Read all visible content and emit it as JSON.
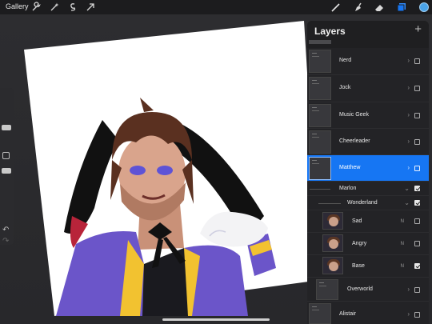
{
  "topbar": {
    "gallery_label": "Gallery",
    "left_tools": [
      "wrench-icon",
      "magic-wand-icon",
      "selection-icon",
      "transform-arrow-icon"
    ],
    "right_tools": [
      "brush-icon",
      "smudge-icon",
      "eraser-icon",
      "layers-icon"
    ],
    "active_color": "#4aa3e8"
  },
  "layers_panel": {
    "title": "Layers",
    "add_label": "+",
    "layers": [
      {
        "name": "Nerd",
        "visible": false
      },
      {
        "name": "Jock",
        "visible": false
      },
      {
        "name": "Music Geek",
        "visible": false
      },
      {
        "name": "Cheerleader",
        "visible": false
      },
      {
        "name": "Matthew",
        "visible": false,
        "selected": true
      },
      {
        "name": "Marlon",
        "group": true,
        "expanded": true,
        "visible": true
      },
      {
        "name": "Wonderland",
        "group": true,
        "expanded": true,
        "visible": true
      },
      {
        "name": "Sad",
        "blend": "N",
        "visible": false
      },
      {
        "name": "Angry",
        "blend": "N",
        "visible": false
      },
      {
        "name": "Base",
        "blend": "N",
        "visible": true
      },
      {
        "name": "Overworld",
        "visible": false
      },
      {
        "name": "Alistair",
        "visible": false
      }
    ]
  },
  "colors": {
    "selected_layer": "#1676f3",
    "character_outfit": "#6b55c9",
    "character_hair": "#5a3020"
  }
}
